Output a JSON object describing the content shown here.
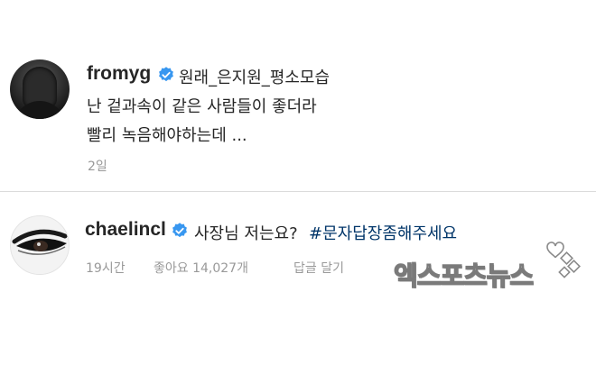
{
  "post": {
    "username": "fromyg",
    "caption_line1": "원래_은지원_평소모습",
    "caption_line2": "난 겉과속이 같은 사람들이 좋더라",
    "caption_line3": "빨리 녹음해야하는데 ...",
    "time": "2일",
    "avatar_icon": "hooded-figure-avatar",
    "verified_icon": "verified-badge-icon"
  },
  "reply": {
    "username": "chaelincl",
    "text": "사장님 저는요?",
    "hashtag": "#문자답장좀해주세요",
    "time": "19시간",
    "likes": "좋아요 14,027개",
    "reply_action": "답글 달기",
    "avatar_icon": "eye-makeup-avatar",
    "verified_icon": "verified-badge-icon"
  },
  "watermark": {
    "text": "엑스포츠뉴스"
  },
  "colors": {
    "verified_blue": "#3897f0",
    "hashtag": "#003569",
    "meta_gray": "#999999",
    "divider": "#dbdbdb"
  }
}
